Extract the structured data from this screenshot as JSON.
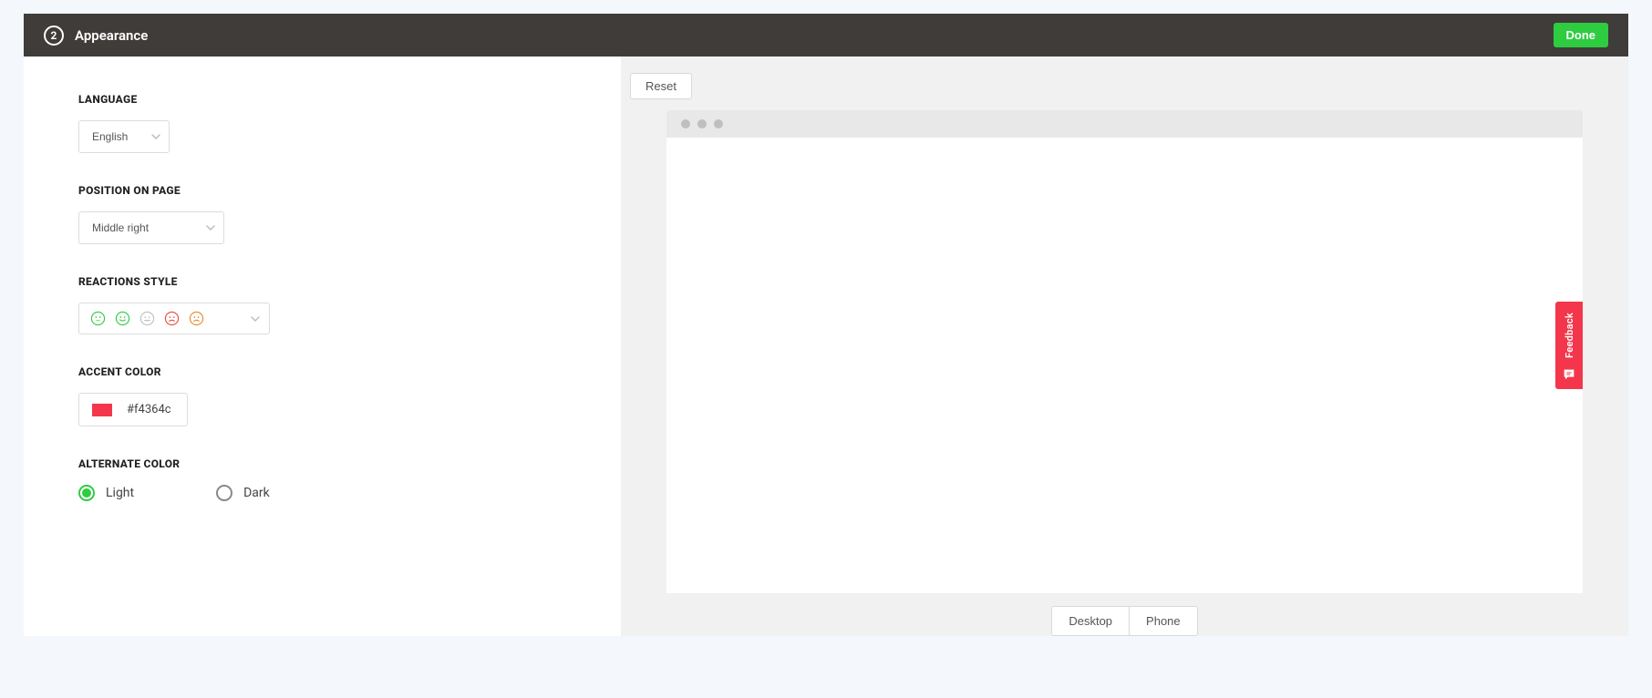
{
  "step": {
    "number": "2",
    "title": "Appearance"
  },
  "actions": {
    "done": "Done",
    "reset": "Reset"
  },
  "form": {
    "language": {
      "label": "LANGUAGE",
      "value": "English"
    },
    "position": {
      "label": "POSITION ON PAGE",
      "value": "Middle right"
    },
    "reactions": {
      "label": "REACTIONS STYLE",
      "faces": [
        {
          "name": "face-grin-icon",
          "color": "#2ecc40",
          "mouth": "smile-open"
        },
        {
          "name": "face-smile-icon",
          "color": "#2ecc40",
          "mouth": "smile"
        },
        {
          "name": "face-neutral-icon",
          "color": "#bfbfbf",
          "mouth": "flat"
        },
        {
          "name": "face-frown-icon",
          "color": "#e74c3c",
          "mouth": "frown"
        },
        {
          "name": "face-sad-icon",
          "color": "#e78a2e",
          "mouth": "frown"
        }
      ]
    },
    "accent": {
      "label": "ACCENT COLOR",
      "value": "#f4364c"
    },
    "alternate": {
      "label": "ALTERNATE COLOR",
      "options": {
        "light": "Light",
        "dark": "Dark"
      },
      "selected": "light"
    }
  },
  "preview": {
    "feedback_tab_label": "Feedback",
    "view_toggle": {
      "desktop": "Desktop",
      "phone": "Phone"
    }
  },
  "colors": {
    "accent": "#f4364c",
    "brand_green": "#2ecc40"
  }
}
